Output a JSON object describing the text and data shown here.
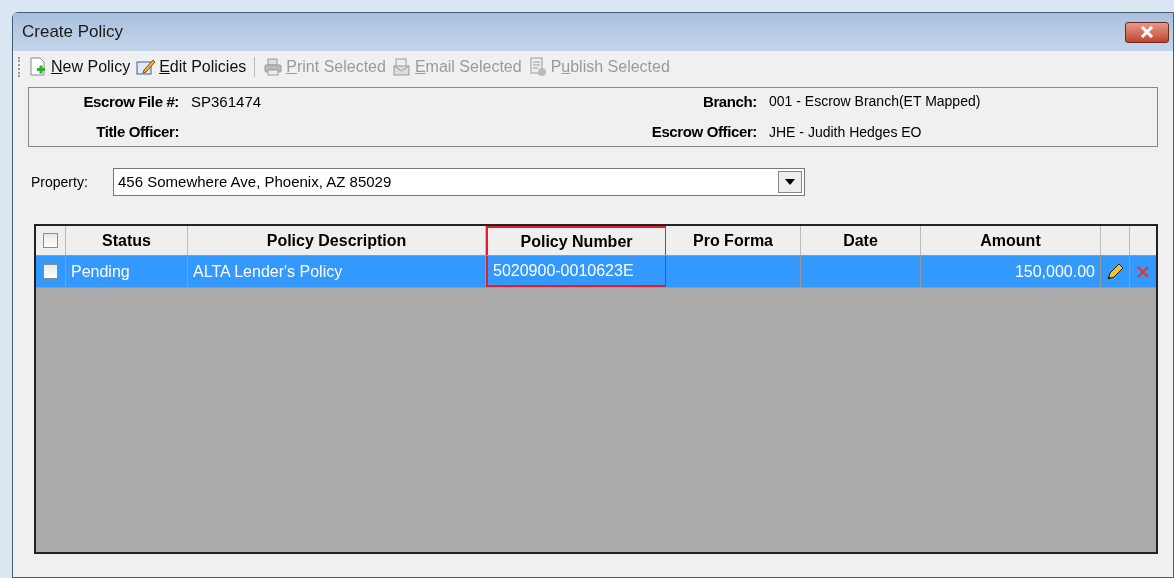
{
  "window": {
    "title": "Create Policy"
  },
  "toolbar": [
    {
      "kind": "new",
      "key": "N",
      "post": "ew Policy",
      "disabled": false
    },
    {
      "kind": "edit",
      "key": "E",
      "post": "dit Policies",
      "disabled": false
    },
    {
      "kind": "print",
      "key": "P",
      "post": "rint Selected",
      "disabled": true
    },
    {
      "kind": "email",
      "key": "E",
      "post": "mail Selected",
      "disabled": true
    },
    {
      "kind": "publish",
      "pre": "P",
      "key": "u",
      "post": "blish Selected",
      "disabled": true
    }
  ],
  "info": {
    "left": [
      {
        "label": "Escrow File #:",
        "value": "SP361474"
      },
      {
        "label": "Title Officer:"
      }
    ],
    "right": [
      {
        "label": "Branch:",
        "value": "001 - Escrow Branch(ET Mapped)"
      },
      {
        "label": "Escrow Officer:",
        "value": "JHE - Judith Hedges EO"
      }
    ]
  },
  "property": {
    "label": "Property:",
    "value": "456 Somewhere Ave, Phoenix, AZ 85029"
  },
  "table": {
    "select_all": {
      "checked": false
    },
    "columns": [
      {
        "label": "Status",
        "highlighted": false
      },
      {
        "label": "Policy Description",
        "highlighted": false
      },
      {
        "label": "Policy Number",
        "highlighted": true
      },
      {
        "label": "Pro Forma",
        "highlighted": false
      },
      {
        "label": "Date",
        "highlighted": false
      },
      {
        "label": "Amount",
        "highlighted": false
      }
    ],
    "rows": [
      {
        "selected": true,
        "checked": false,
        "cells": [
          "Pending",
          "ALTA Lender's Policy",
          "5020900-0010623E",
          "",
          "",
          "150,000.00"
        ]
      }
    ]
  }
}
